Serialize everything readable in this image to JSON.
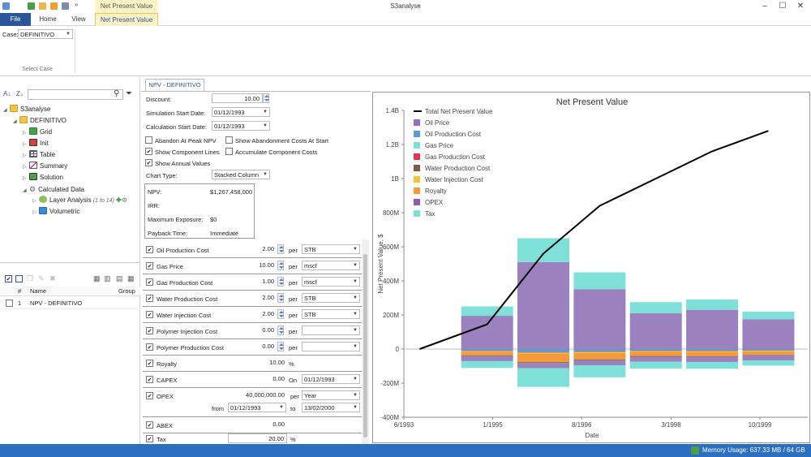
{
  "window": {
    "title": "S3analyse",
    "context_tab_group": "Net Present Value"
  },
  "ribbon_tabs": {
    "file": "File",
    "home": "Home",
    "view": "View",
    "npv": "Net Present Value"
  },
  "ribbon": {
    "case_label": "Case:",
    "case_value": "DEFINITIVO",
    "group_label": "Select Case"
  },
  "tree": {
    "root": "S3analyse",
    "case": "DEFINITIVO",
    "items": [
      "Grid",
      "Init",
      "Table",
      "Summary",
      "Solution"
    ],
    "calculated": "Calculated Data",
    "layer_analysis": "Layer Analysis",
    "layer_range": "(1 to 14)",
    "volumetric": "Volumetric"
  },
  "caselist": {
    "col_hash": "#",
    "col_name": "Name",
    "col_group": "Group",
    "rows": [
      {
        "num": "1",
        "name": "NPV - DEFINITIVO"
      }
    ]
  },
  "doc_tab": "NPV - DEFINITIVO",
  "settings": {
    "discount_label": "Discount:",
    "discount_value": "10.00",
    "sim_start_label": "Simulation Start Date:",
    "sim_start_value": "01/12/1993",
    "calc_start_label": "Calculation Start Date:",
    "calc_start_value": "01/12/1993",
    "abandon_peak": "Abandon At Peak NPV",
    "show_abandon": "Show Abandonment Costs At Start",
    "show_component": "Show Component Lines",
    "accumulate": "Accumulate Component Costs",
    "show_annual": "Show Annual Values",
    "chart_type_label": "Chart Type:",
    "chart_type_value": "Stacked Column"
  },
  "results": {
    "npv_label": "NPV:",
    "npv_value": "$1,267,458,000",
    "irr_label": "IRR:",
    "max_exposure_label": "Maximum Exposure:",
    "max_exposure_value": "$0",
    "payback_label": "Payback Time:",
    "payback_value": "Immediate"
  },
  "params": [
    {
      "name": "Oil Production Cost",
      "value": "2.00",
      "per": "per",
      "unit": "STB"
    },
    {
      "name": "Gas Price",
      "value": "10.00",
      "per": "per",
      "unit": "mscf"
    },
    {
      "name": "Gas Production Cost",
      "value": "1.00",
      "per": "per",
      "unit": "mscf"
    },
    {
      "name": "Water Production Cost",
      "value": "2.00",
      "per": "per",
      "unit": "STB"
    },
    {
      "name": "Water Injection Cost",
      "value": "2.00",
      "per": "per",
      "unit": "STB"
    },
    {
      "name": "Polymer Injection Cost",
      "value": "0.00",
      "per": "per",
      "unit": ""
    },
    {
      "name": "Polymer Production Cost",
      "value": "0.00",
      "per": "per",
      "unit": ""
    },
    {
      "name": "Royalty",
      "value": "10.00",
      "per": "%",
      "unit": ""
    },
    {
      "name": "CAPEX",
      "value": "0.00",
      "per": "On",
      "unit": "01/12/1993"
    }
  ],
  "opex": {
    "name": "OPEX",
    "value": "40,000,000.00",
    "per": "per",
    "unit": "Year",
    "from_label": "from",
    "from": "01/12/1993",
    "to_label": "to",
    "to": "13/02/2000"
  },
  "abex": {
    "name": "ABEX",
    "value": "0.00"
  },
  "tax": {
    "name": "Tax",
    "value": "20.00",
    "unit": "%"
  },
  "status": {
    "memory": "Memory Usage: 637.33 MB / 64 GB"
  },
  "colors": {
    "accent": "#2b579a",
    "status": "#2b6fc2"
  },
  "chart_data": {
    "type": "bar",
    "title": "Net Present Value",
    "xlabel": "Date",
    "ylabel": "Net Present Value, $",
    "ylim": [
      -400,
      1400
    ],
    "y_unit": "M",
    "yticks": [
      -400,
      -200,
      0,
      200,
      400,
      600,
      800,
      1000,
      1200,
      1400
    ],
    "yticklabels": [
      "-400M",
      "-200M",
      "0",
      "200M",
      "400M",
      "600M",
      "800M",
      "1B",
      "1.2B",
      "1.4B"
    ],
    "xticks": [
      "6/1993",
      "1/1995",
      "8/1996",
      "3/1998",
      "10/1999"
    ],
    "xtick_years": [
      1993.42,
      1995.0,
      1996.58,
      1998.17,
      1999.75
    ],
    "xlim": [
      1993.42,
      2000.6
    ],
    "legend": [
      "Total Net Present Value",
      "Oil Price",
      "Oil Production Cost",
      "Gas Price",
      "Gas Production Cost",
      "Water Production Cost",
      "Water Injection Cost",
      "Royalty",
      "OPEX",
      "Tax"
    ],
    "legend_colors": [
      "#000000",
      "#9370b8",
      "#5b9bd5",
      "#7ee0d8",
      "#e0344f",
      "#7a5c46",
      "#f5c432",
      "#f39a3c",
      "#8e5bb0",
      "#7ee0d8"
    ],
    "legend_position": "top-left",
    "bar_years": [
      1994.9,
      1995.9,
      1996.9,
      1997.9,
      1998.9,
      1999.9
    ],
    "positive": [
      {
        "name": "Oil Price",
        "color": "#9b82bf",
        "values": [
          195,
          510,
          350,
          210,
          230,
          175
        ]
      },
      {
        "name": "Tax",
        "color": "#7ee0d8",
        "values": [
          55,
          140,
          100,
          65,
          60,
          45
        ]
      }
    ],
    "negative": [
      {
        "name": "Oil Production Cost",
        "color": "#5b9bd5",
        "values": [
          -10,
          -18,
          -14,
          -10,
          -10,
          -8
        ]
      },
      {
        "name": "Gas Production Cost",
        "color": "#e0344f",
        "values": [
          -2,
          -3,
          -3,
          -2,
          -2,
          -2
        ]
      },
      {
        "name": "Water Injection Cost",
        "color": "#f5c432",
        "values": [
          -5,
          -6,
          -6,
          -5,
          -5,
          -4
        ]
      },
      {
        "name": "Royalty",
        "color": "#f39a3c",
        "values": [
          -20,
          -50,
          -38,
          -24,
          -25,
          -20
        ]
      },
      {
        "name": "Water Production Cost",
        "color": "#7a5c46",
        "values": [
          -4,
          -5,
          -5,
          -4,
          -4,
          -3
        ]
      },
      {
        "name": "OPEX",
        "color": "#9b82bf",
        "values": [
          -30,
          -30,
          -30,
          -30,
          -30,
          -30
        ]
      },
      {
        "name": "Tax",
        "color": "#7ee0d8",
        "values": [
          -40,
          -110,
          -70,
          -40,
          -40,
          -30
        ]
      }
    ],
    "line": {
      "name": "Total Net Present Value",
      "color": "#000000",
      "x": [
        1993.7,
        1994.9,
        1995.9,
        1996.9,
        1997.9,
        1998.9,
        1999.9
      ],
      "y": [
        0,
        145,
        560,
        840,
        1000,
        1160,
        1280
      ]
    }
  }
}
